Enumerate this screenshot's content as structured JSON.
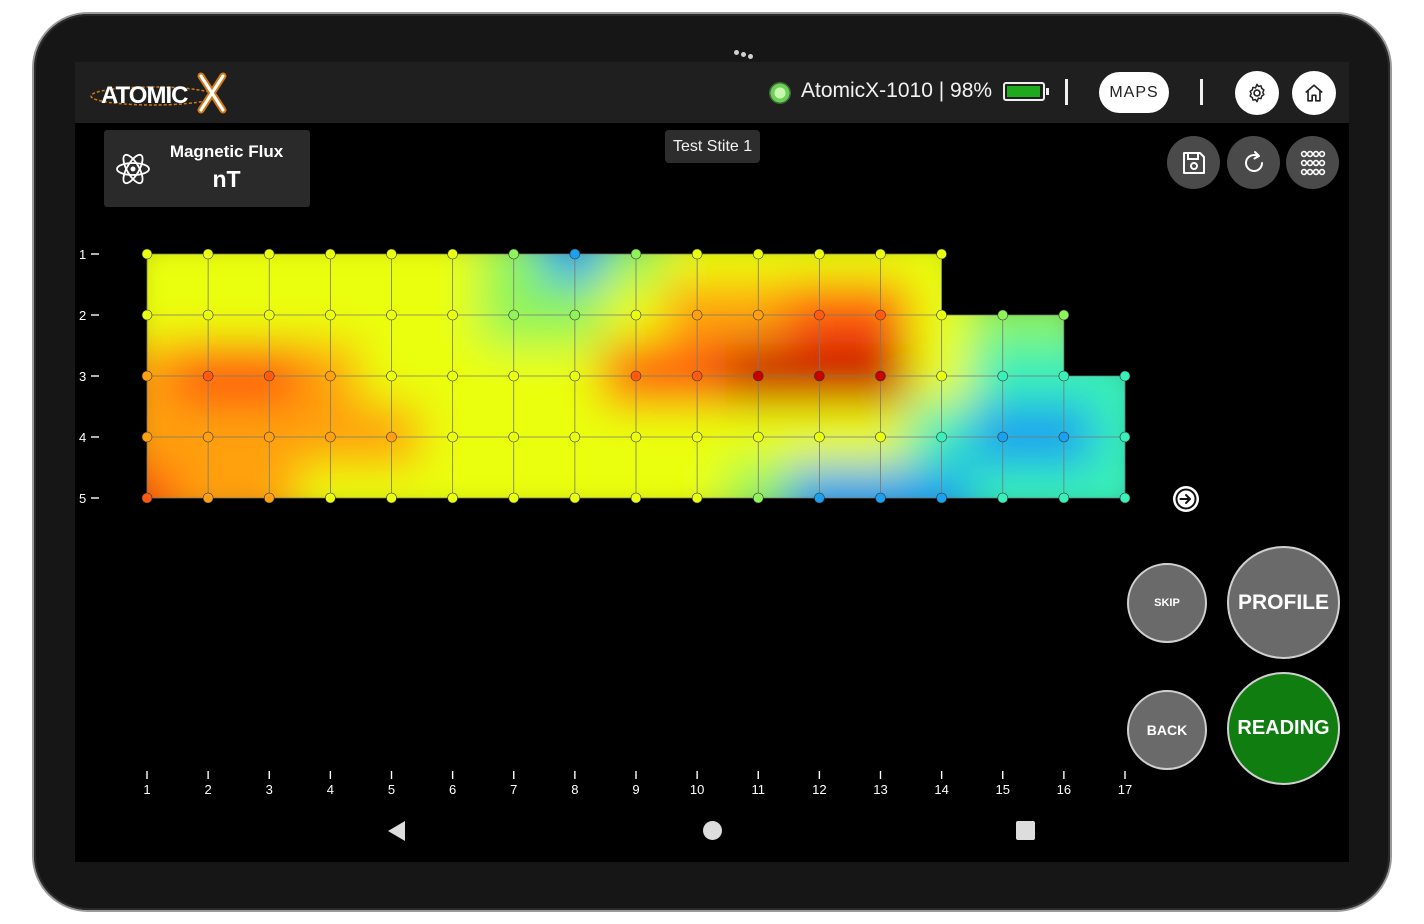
{
  "app": {
    "logo_text": "ATOMICX",
    "device_status": "AtomicX-1010 | 98%",
    "battery_level": 0.98,
    "connection_status_color": "#6fcf5a",
    "maps_label": "MAPS"
  },
  "icons": {
    "settings": "gear-icon",
    "home": "home-icon",
    "save": "save-icon",
    "refresh": "refresh-icon",
    "grid": "grid-icon",
    "next": "arrow-right-icon",
    "mode": "atom-icon"
  },
  "mode": {
    "label": "Magnetic Flux",
    "unit": "nT"
  },
  "site": {
    "name": "Test Stite 1"
  },
  "controls": {
    "skip_label": "SKIP",
    "profile_label": "PROFILE",
    "back_label": "BACK",
    "reading_label": "READING",
    "reading_color": "#0f7d0f"
  },
  "chart_data": {
    "type": "heatmap",
    "x_ticks": [
      "1",
      "2",
      "3",
      "4",
      "5",
      "6",
      "7",
      "8",
      "9",
      "10",
      "11",
      "12",
      "13",
      "14",
      "15",
      "16",
      "17"
    ],
    "y_ticks": [
      "1",
      "2",
      "3",
      "4",
      "5"
    ],
    "row_lengths": [
      14,
      16,
      17,
      17,
      17
    ],
    "color_scale": [
      "#0a16d2",
      "#1aa0f0",
      "#38f0b8",
      "#8ef45a",
      "#eaff10",
      "#ffa010",
      "#ff5a10",
      "#c80000"
    ],
    "levels": [
      [
        4,
        4,
        4,
        4,
        4,
        3.5,
        2.5,
        0.5,
        3,
        4,
        4,
        4,
        4,
        4
      ],
      [
        4,
        4,
        4,
        4,
        4,
        3.5,
        3,
        3,
        3.5,
        4.5,
        5,
        6,
        6,
        4,
        2.5,
        2.5
      ],
      [
        5,
        5.5,
        5.5,
        5,
        4,
        4,
        4,
        4,
        5.5,
        6,
        7,
        7,
        7,
        4,
        2,
        1.5,
        1.5
      ],
      [
        5,
        5,
        5,
        5,
        5,
        4,
        4,
        4,
        4,
        4,
        4,
        4,
        4,
        2,
        0.5,
        0.5,
        2
      ],
      [
        5.5,
        5,
        5,
        4,
        4,
        4,
        4,
        4,
        3.5,
        3.5,
        2.5,
        1,
        1,
        1,
        1.5,
        1.5,
        2
      ]
    ]
  }
}
